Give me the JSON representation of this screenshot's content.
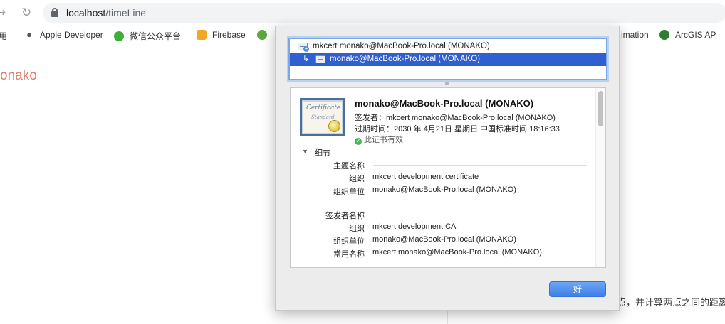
{
  "browser": {
    "back_icon": "arrow-right-icon",
    "reload_icon": "reload-icon",
    "url_host": "localhost",
    "url_path": "/timeLine"
  },
  "bookmarks": [
    {
      "label": "用",
      "icon": "apps-icon"
    },
    {
      "label": "Apple Developer",
      "icon": "apple-icon"
    },
    {
      "label": "微信公众平台",
      "icon": "wechat-icon"
    },
    {
      "label": "Firebase",
      "icon": "firebase-icon"
    },
    {
      "label": "imation",
      "icon": ""
    },
    {
      "label": "ArcGIS AP",
      "icon": "globe-icon"
    }
  ],
  "page": {
    "brand": "onako",
    "bg_text": "点，并计算两点之间的距离"
  },
  "dialog": {
    "chain": [
      {
        "label": "mkcert monako@MacBook-Pro.local (MONAKO)",
        "icon": "certificate-authority-icon",
        "selected": false
      },
      {
        "label": "monako@MacBook-Pro.local (MONAKO)",
        "icon": "certificate-icon",
        "selected": true
      }
    ],
    "cert": {
      "image_text_1": "Certificate",
      "image_text_2": "Standard",
      "title": "monako@MacBook-Pro.local (MONAKO)",
      "issuer_line": "签发者：mkcert monako@MacBook-Pro.local (MONAKO)",
      "expiry_line": "过期时间：2030 年 4月21日 星期日 中国标准时间 18:16:33",
      "valid_text": "此证书有效"
    },
    "details": {
      "section_label": "细节",
      "subject_head": "主题名称",
      "subject": [
        {
          "key": "组织",
          "value": "mkcert development certificate"
        },
        {
          "key": "组织单位",
          "value": "monako@MacBook-Pro.local (MONAKO)"
        }
      ],
      "issuer_head": "签发者名称",
      "issuer": [
        {
          "key": "组织",
          "value": "mkcert development CA"
        },
        {
          "key": "组织单位",
          "value": "monako@MacBook-Pro.local (MONAKO)"
        },
        {
          "key": "常用名称",
          "value": "mkcert monako@MacBook-Pro.local (MONAKO)"
        }
      ]
    },
    "ok_label": "好"
  },
  "colors": {
    "accent": "#3d7fe8",
    "selection": "#2f5fd0",
    "brand": "#e07b6a",
    "valid": "#3dbb54"
  }
}
